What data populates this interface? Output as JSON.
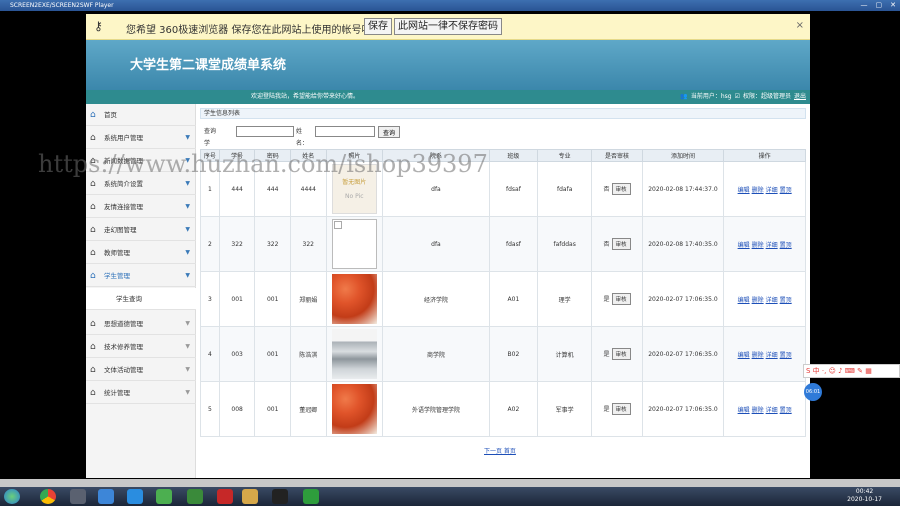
{
  "window": {
    "title": "SCREEN2EXE/SCREEN2SWF Player",
    "controls": [
      "—",
      "▢",
      "✕"
    ]
  },
  "savebar": {
    "message": "您希望 360极速浏览器 保存您在此网站上使用的帐号吗?",
    "save_label": "保存",
    "never_label": "此网站一律不保存密码",
    "close_label": "×"
  },
  "header": {
    "title": "大学生第二课堂成绩单系统",
    "welcome": "欢迎登陆我站，希望能给你带来好心情。",
    "user_label": "当前用户：hsg",
    "role_label": "权限：超级管理员",
    "exit_label": "退出"
  },
  "sidebar": {
    "items": [
      {
        "label": "首页",
        "icon": "home-icon"
      },
      {
        "label": "系统用户管理",
        "icon": "house-icon"
      },
      {
        "label": "新闻数据管理",
        "icon": "house-icon"
      },
      {
        "label": "系统简介设置",
        "icon": "house-icon"
      },
      {
        "label": "友情连接管理",
        "icon": "house-icon"
      },
      {
        "label": "走幻图管理",
        "icon": "house-icon"
      },
      {
        "label": "教师管理",
        "icon": "house-icon"
      },
      {
        "label": "学生管理",
        "icon": "house-icon"
      },
      {
        "label": "学生查询",
        "icon": ""
      },
      {
        "label": "思想道德管理",
        "icon": "house-icon"
      },
      {
        "label": "技术修养管理",
        "icon": "house-icon"
      },
      {
        "label": "文体活动管理",
        "icon": "house-icon"
      },
      {
        "label": "统计管理",
        "icon": "house-icon"
      }
    ]
  },
  "main": {
    "breadcrumb": "学生信息列表",
    "search": {
      "xuehao_label": "查询 学号：",
      "name_label": "姓名：",
      "button": "查询",
      "xuehao_value": "",
      "name_value": ""
    },
    "columns": [
      "序号",
      "学号",
      "密码",
      "姓名",
      "照片",
      "院系",
      "班级",
      "专业",
      "是否审核",
      "添加时间",
      "操作"
    ],
    "rows": [
      {
        "no": "1",
        "xuehao": "444",
        "pwd": "444",
        "name": "4444",
        "photo": "nopic",
        "dept": "dfa",
        "cls": "fdsaf",
        "major": "fdafa",
        "audit": "否",
        "time": "2020-02-08 17:44:37.0"
      },
      {
        "no": "2",
        "xuehao": "322",
        "pwd": "322",
        "name": "322",
        "photo": "broken",
        "dept": "dfa",
        "cls": "fdasf",
        "major": "fafddas",
        "audit": "否",
        "time": "2020-02-08 17:40:35.0"
      },
      {
        "no": "3",
        "xuehao": "001",
        "pwd": "001",
        "name": "郑丽娟",
        "photo": "shrimp",
        "dept": "经济学院",
        "cls": "A01",
        "major": "理学",
        "audit": "是",
        "time": "2020-02-07 17:06:35.0"
      },
      {
        "no": "4",
        "xuehao": "003",
        "pwd": "001",
        "name": "陈浩淇",
        "photo": "fish",
        "dept": "商学院",
        "cls": "B02",
        "major": "计算机",
        "audit": "是",
        "time": "2020-02-07 17:06:35.0"
      },
      {
        "no": "5",
        "xuehao": "008",
        "pwd": "001",
        "name": "董冠卿",
        "photo": "shrimp",
        "dept": "外语学院管理学院",
        "cls": "A02",
        "major": "军事学",
        "audit": "是",
        "time": "2020-02-07 17:06:35.0"
      }
    ],
    "audit_btn": "审核",
    "ops": [
      "编辑",
      "删除",
      "详细",
      "置顶"
    ],
    "nopic_text": [
      "暂无图片",
      "No Pic"
    ],
    "pager": "下一页 首页"
  },
  "watermark": "https://www.huzhan.com/ishop39397",
  "ime": "S 中 ·, ☺ ♪ ⌨ ✎ ▦",
  "clock_badge": "06:01",
  "taskbar": {
    "time": "00:42",
    "date": "2020-10-17"
  }
}
